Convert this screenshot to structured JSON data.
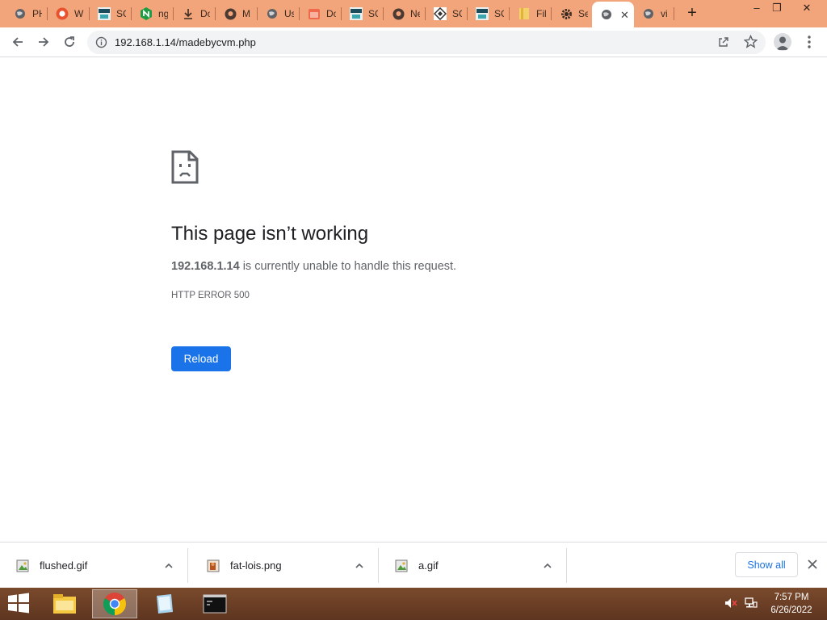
{
  "tabs": [
    {
      "label": "PH",
      "icon": "globe-icon"
    },
    {
      "label": "W",
      "icon": "whatsapp-icon"
    },
    {
      "label": "SC",
      "icon": "sqlite-icon"
    },
    {
      "label": "ng",
      "icon": "nginx-icon"
    },
    {
      "label": "Do",
      "icon": "download-icon"
    },
    {
      "label": "M",
      "icon": "github-icon"
    },
    {
      "label": "Us",
      "icon": "globe-icon"
    },
    {
      "label": "Do",
      "icon": "calendar-icon"
    },
    {
      "label": "SC",
      "icon": "sqlite-icon"
    },
    {
      "label": "Ne",
      "icon": "github-icon"
    },
    {
      "label": "SC",
      "icon": "diamond-icon"
    },
    {
      "label": "SC",
      "icon": "sqlite-icon"
    },
    {
      "label": "Fil",
      "icon": "file-icon"
    },
    {
      "label": "Se",
      "icon": "gear-icon"
    },
    {
      "label": "",
      "icon": "globe-icon",
      "active": true
    },
    {
      "label": "vi",
      "icon": "globe-icon"
    }
  ],
  "window_controls": {
    "minimize": "–",
    "restore": "❐",
    "close": "✕"
  },
  "toolbar": {
    "url": "192.168.1.14/madebycvm.php"
  },
  "error": {
    "title": "This page isn’t working",
    "host": "192.168.1.14",
    "message": " is currently unable to handle this request.",
    "code": "HTTP ERROR 500",
    "reload_label": "Reload"
  },
  "downloads": [
    {
      "name": "flushed.gif",
      "icon": "image-file-icon"
    },
    {
      "name": "fat-lois.png",
      "icon": "image-file-icon"
    },
    {
      "name": "a.gif",
      "icon": "image-file-icon"
    }
  ],
  "shelf": {
    "show_all_label": "Show all"
  },
  "taskbar": {
    "time": "7:57 PM",
    "date": "6/26/2022"
  },
  "colors": {
    "tabstrip": "#f2a47a",
    "accent": "#1a73e8",
    "taskbar": "#6b3f25"
  }
}
